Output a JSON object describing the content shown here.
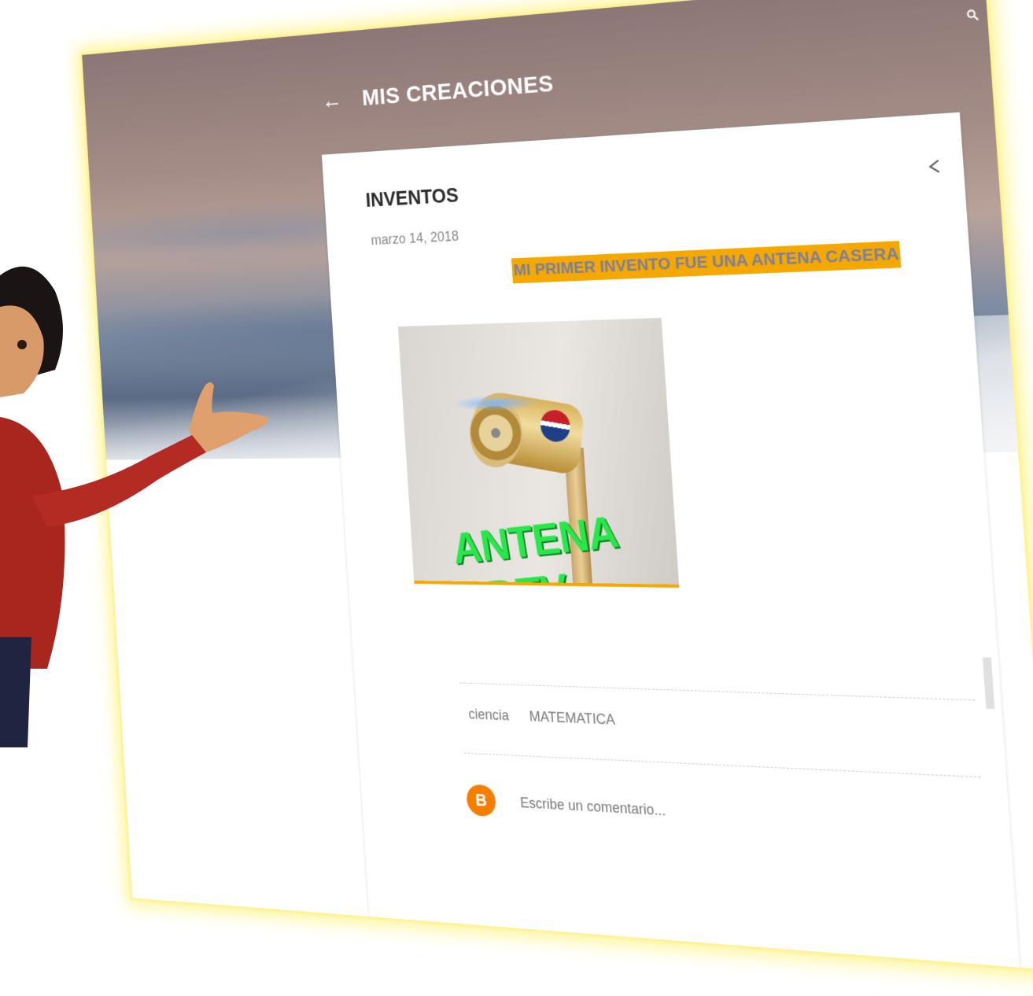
{
  "header": {
    "back_icon": "arrow-left-icon",
    "blog_title": "MIS CREACIONES",
    "search_icon": "search-icon"
  },
  "post": {
    "title": "INVENTOS",
    "share_icon": "share-icon",
    "date": "marzo 14, 2018",
    "headline": "MI PRIMER INVENTO FUE UNA ANTENA CASERA",
    "image_caption": "ANTENA HDTV",
    "labels": [
      "ciencia",
      "MATEMATICA"
    ]
  },
  "comments": {
    "placeholder": "Escribe un comentario...",
    "avatar_icon": "blogger-icon"
  },
  "colors": {
    "accent": "#f5a800",
    "blogger_orange": "#f57d00",
    "glow": "#fff59a",
    "caption_green": "#29e64a"
  }
}
